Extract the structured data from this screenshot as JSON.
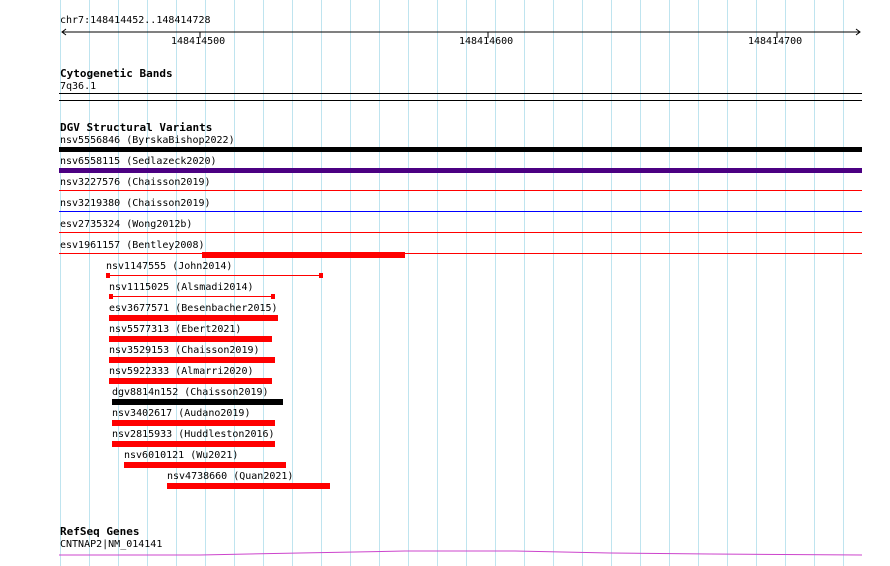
{
  "locus": "chr7:148414452..148414728",
  "ruler": {
    "ticks": [
      {
        "label": "148414500",
        "pos": 148414500
      },
      {
        "label": "148414600",
        "pos": 148414600
      },
      {
        "label": "148414700",
        "pos": 148414700
      }
    ]
  },
  "tracks": {
    "cytoband": {
      "title": "Cytogenetic Bands",
      "label": "7q36.1"
    },
    "dgv": {
      "title": "DGV Structural Variants",
      "wide_variants": [
        {
          "label": "nsv5556846 (ByrskaBishop2022)",
          "color": "#000000",
          "thickness": "thick"
        },
        {
          "label": "nsv6558115 (Sedlazeck2020)",
          "color": "#4b0082",
          "thickness": "thick"
        },
        {
          "label": "nsv3227576 (Chaisson2019)",
          "color": "#ff0000",
          "thickness": "thin"
        },
        {
          "label": "nsv3219380 (Chaisson2019)",
          "color": "#0000ff",
          "thickness": "thin"
        },
        {
          "label": "esv2735324 (Wong2012b)",
          "color": "#ff0000",
          "thickness": "thin"
        },
        {
          "label": "esv1961157 (Bentley2008)",
          "color": "#ff0000",
          "thickness": "thin"
        }
      ],
      "local_variants": [
        {
          "label": "nsv1147555 (John2014)",
          "color": "#ff0000",
          "style": "dumbbell"
        },
        {
          "label": "nsv1115025 (Alsmadi2014)",
          "color": "#ff0000",
          "style": "dumbbell"
        },
        {
          "label": "esv3677571 (Besenbacher2015)",
          "color": "#ff0000",
          "style": "box"
        },
        {
          "label": "nsv5577313 (Ebert2021)",
          "color": "#ff0000",
          "style": "box"
        },
        {
          "label": "nsv3529153 (Chaisson2019)",
          "color": "#ff0000",
          "style": "box"
        },
        {
          "label": "nsv5922333 (Almarri2020)",
          "color": "#ff0000",
          "style": "box"
        },
        {
          "label": "dgv8814n152 (Chaisson2019)",
          "color": "#000000",
          "style": "box"
        },
        {
          "label": "nsv3402617 (Audano2019)",
          "color": "#ff0000",
          "style": "box"
        },
        {
          "label": "nsv2815933 (Huddleston2016)",
          "color": "#ff0000",
          "style": "box"
        },
        {
          "label": "nsv6010121 (Wu2021)",
          "color": "#ff0000",
          "style": "box"
        },
        {
          "label": "nsv4738660 (Quan2021)",
          "color": "#ff0000",
          "style": "box"
        },
        {
          "label": "",
          "color": "#ff0000",
          "style": "box"
        }
      ]
    },
    "refseq": {
      "title": "RefSeq Genes",
      "label": "CNTNAP2|NM_014141",
      "color": "#cc44cc"
    }
  }
}
